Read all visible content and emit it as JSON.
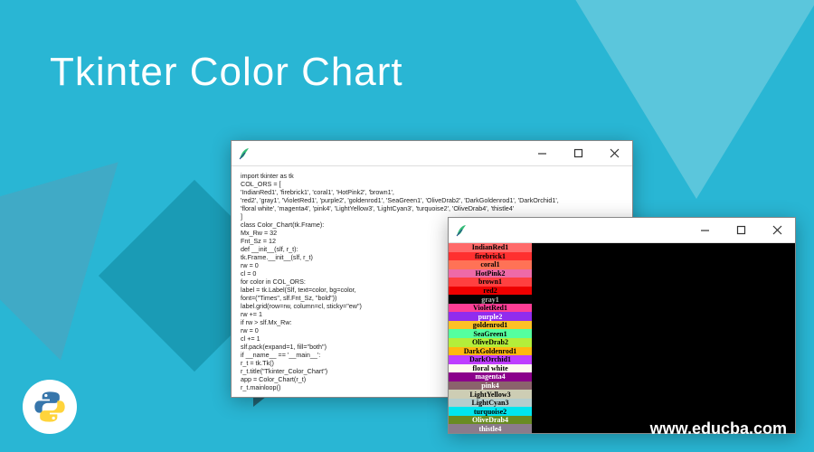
{
  "page": {
    "title": "Tkinter Color Chart",
    "footer_url": "www.educba.com"
  },
  "code_window": {
    "code": "import tkinter as tk\nCOL_ORS = [\n'IndianRed1', 'firebrick1', 'coral1', 'HotPink2', 'brown1',\n'red2', 'gray1', 'VioletRed1', 'purple2', 'goldenrod1', 'SeaGreen1', 'OliveDrab2', 'DarkGoldenrod1', 'DarkOrchid1',\n'floral white', 'magenta4', 'pink4', 'LightYellow3', 'LightCyan3', 'turquoise2', 'OliveDrab4', 'thistle4'\n]\nclass Color_Chart(tk.Frame):\nMx_Rw = 32\nFnt_Sz = 12\ndef __init__(slf, r_t):\ntk.Frame.__init__(slf, r_t)\nrw = 0\ncl = 0\nfor color in COL_ORS:\nlabel = tk.Label(Slf, text=color, bg=color,\nfont=(\"Times\", slf.Fnt_Sz, \"bold\"))\nlabel.grid(row=rw, column=cl, sticky=\"ew\")\nrw += 1\nif rw > slf.Mx_Rw:\nrw = 0\ncl += 1\nslf.pack(expand=1, fill=\"both\")\nif __name__ == '__main__':\nr_t = tk.Tk()\nr_t.title(\"Tkinter_Color_Chart\")\napp = Color_Chart(r_t)\nr_t.mainloop()"
  },
  "color_window": {
    "swatches": [
      {
        "name": "IndianRed1",
        "bg": "#ff6a6a",
        "fg": "#000"
      },
      {
        "name": "firebrick1",
        "bg": "#ff3030",
        "fg": "#000"
      },
      {
        "name": "coral1",
        "bg": "#ff7256",
        "fg": "#000"
      },
      {
        "name": "HotPink2",
        "bg": "#ee6aa7",
        "fg": "#000"
      },
      {
        "name": "brown1",
        "bg": "#ff4040",
        "fg": "#000"
      },
      {
        "name": "red2",
        "bg": "#ee0000",
        "fg": "#000"
      },
      {
        "name": "gray1",
        "bg": "#030303",
        "fg": "#bbb"
      },
      {
        "name": "VioletRed1",
        "bg": "#ff3e96",
        "fg": "#000"
      },
      {
        "name": "purple2",
        "bg": "#912cee",
        "fg": "#fff"
      },
      {
        "name": "goldenrod1",
        "bg": "#ffc125",
        "fg": "#000"
      },
      {
        "name": "SeaGreen1",
        "bg": "#54ff9f",
        "fg": "#000"
      },
      {
        "name": "OliveDrab2",
        "bg": "#b3ee3a",
        "fg": "#000"
      },
      {
        "name": "DarkGoldenrod1",
        "bg": "#ffb90f",
        "fg": "#000"
      },
      {
        "name": "DarkOrchid1",
        "bg": "#bf3eff",
        "fg": "#000"
      },
      {
        "name": "floral white",
        "bg": "#fffaf0",
        "fg": "#000"
      },
      {
        "name": "magenta4",
        "bg": "#8b008b",
        "fg": "#fff"
      },
      {
        "name": "pink4",
        "bg": "#8b636c",
        "fg": "#fff"
      },
      {
        "name": "LightYellow3",
        "bg": "#cdcdb4",
        "fg": "#000"
      },
      {
        "name": "LightCyan3",
        "bg": "#b4cdcd",
        "fg": "#000"
      },
      {
        "name": "turquoise2",
        "bg": "#00e5ee",
        "fg": "#000"
      },
      {
        "name": "OliveDrab4",
        "bg": "#698b22",
        "fg": "#fff"
      },
      {
        "name": "thistle4",
        "bg": "#8b7b8b",
        "fg": "#fff"
      }
    ]
  }
}
